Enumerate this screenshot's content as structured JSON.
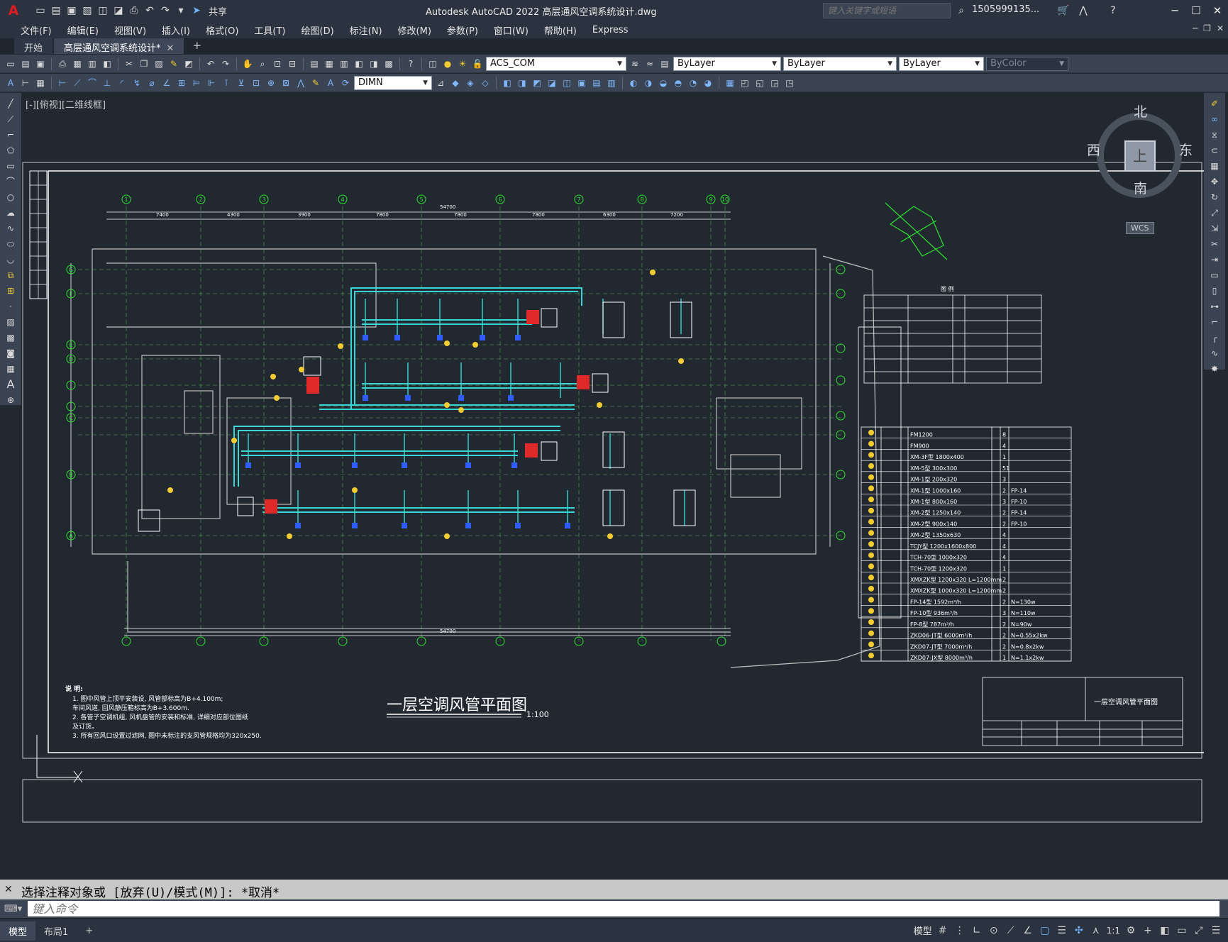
{
  "titlebar": {
    "app_title": "Autodesk AutoCAD 2022    高层通风空调系统设计.dwg",
    "share_label": "共享",
    "search_placeholder": "键入关键字或短语",
    "user": "1505999135...",
    "logo": "A"
  },
  "menu": {
    "items": [
      "文件(F)",
      "编辑(E)",
      "视图(V)",
      "插入(I)",
      "格式(O)",
      "工具(T)",
      "绘图(D)",
      "标注(N)",
      "修改(M)",
      "参数(P)",
      "窗口(W)",
      "帮助(H)",
      "Express"
    ]
  },
  "tabs": [
    {
      "label": "开始",
      "active": false
    },
    {
      "label": "高层通风空调系统设计*",
      "active": true
    }
  ],
  "toolbar1": {
    "ucs": "ACS_COM",
    "layer": "ByLayer",
    "linetype": "ByLayer",
    "lineweight": "ByLayer",
    "plotstyle": "ByColor"
  },
  "toolbar2": {
    "dimstyle": "DIMN"
  },
  "viewport": {
    "label": "[-][俯视][二维线框]",
    "cube": {
      "north": "北",
      "south": "南",
      "east": "东",
      "west": "西",
      "face": "上",
      "wcs": "WCS"
    }
  },
  "drawing": {
    "title": "一层空调风管平面图",
    "scale": "1:100",
    "notes_title": "说 明:",
    "notes": [
      "1. 图中风管上顶平安装设, 风管部标高为B+4.100m;",
      "   车间风道, 回风静压箱标高为B+3.600m.",
      "2. 各管子空调机组, 风机盘管的安装和标准, 详细对应部位图纸",
      "   及订货。",
      "3. 所有回风口设置过滤网, 图中未标注的支风管规格均为320x250."
    ],
    "axes_top": [
      "1",
      "2",
      "3",
      "4",
      "5",
      "6",
      "7",
      "8",
      "9",
      "10"
    ],
    "axes_left": [
      "G",
      "F",
      "E",
      "D",
      "C",
      "B",
      "A"
    ],
    "dims_top": [
      "7400",
      "4300",
      "3900",
      "7800",
      "7800",
      "7800",
      "6300",
      "7200"
    ],
    "total_dim": "54700",
    "title_block": "一层空调风管平面图",
    "legend_title": "图 例"
  },
  "equipment_table": {
    "rows": [
      [
        "FM1200",
        "8",
        ""
      ],
      [
        "FM900",
        "4",
        ""
      ],
      [
        "XM-3F型 1800x400",
        "1",
        ""
      ],
      [
        "XM-5型 300x300",
        "51",
        ""
      ],
      [
        "XM-1型 200x320",
        "3",
        ""
      ],
      [
        "XM-1型 1000x160",
        "2",
        "FP-14"
      ],
      [
        "XM-1型 800x160",
        "3",
        "FP-10"
      ],
      [
        "XM-2型 1250x140",
        "2",
        "FP-14"
      ],
      [
        "XM-2型 900x140",
        "2",
        "FP-10"
      ],
      [
        "XM-2型 1350x630",
        "4",
        ""
      ],
      [
        "TCJY型 1200x1600x800",
        "4",
        ""
      ],
      [
        "TCH-70型 1000x320",
        "4",
        ""
      ],
      [
        "TCH-70型 1200x320",
        "1",
        ""
      ],
      [
        "XMXZK型 1200x320 L=1200mm",
        "2",
        ""
      ],
      [
        "XMXZK型 1000x320 L=1200mm",
        "2",
        ""
      ],
      [
        "FP-14型 1592m³/h",
        "2",
        "N=130w"
      ],
      [
        "FP-10型 936m³/h",
        "3",
        "N=110w"
      ],
      [
        "FP-8型 787m³/h",
        "2",
        "N=90w"
      ],
      [
        "ZKD06-JT型 6000m³/h",
        "2",
        "N=0.55x2kw"
      ],
      [
        "ZKD07-JT型 7000m³/h",
        "2",
        "N=0.8x2kw"
      ],
      [
        "ZKD07-JX型 8000m³/h",
        "1",
        "N=1.1x2kw"
      ]
    ]
  },
  "command": {
    "history": "选择注释对象或 [放弃(U)/模式(M)]: *取消*",
    "placeholder": "键入命令"
  },
  "status": {
    "layouts": [
      "模型",
      "布局1"
    ],
    "model_label": "模型",
    "scale": "1:1"
  },
  "colors": {
    "background": "#212830",
    "duct": "#3ad6d6",
    "line": "#ffffff",
    "axis": "#2fe32f",
    "accent": "#e6c300",
    "red": "#e02a2a"
  }
}
